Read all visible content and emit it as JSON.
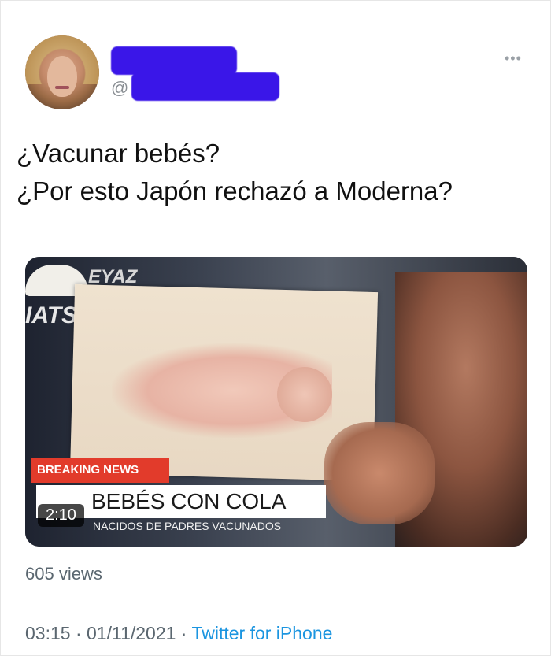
{
  "tweet": {
    "handle_prefix": "@",
    "text_lines": [
      "¿Vacunar bebés?",
      "¿Por esto Japón rechazó a Moderna?"
    ],
    "more_icon": "•••",
    "icons": [
      "more-icon",
      "avatar"
    ]
  },
  "video": {
    "logo_top": "EYAZ",
    "logo_side": "IATS",
    "breaking_label": "BREAKING NEWS",
    "headline": "BEBÉS CON COLA",
    "subheadline": "NACIDOS DE PADRES VACUNADOS",
    "duration": "2:10"
  },
  "stats": {
    "views": "605 views"
  },
  "footer": {
    "time": "03:15",
    "separator1": " · ",
    "date": "01/11/2021",
    "separator2": " · ",
    "source": "Twitter for iPhone"
  },
  "colors": {
    "redaction": "#3a16e8",
    "link": "#1b95e0",
    "breaking": "#e23b2b"
  }
}
